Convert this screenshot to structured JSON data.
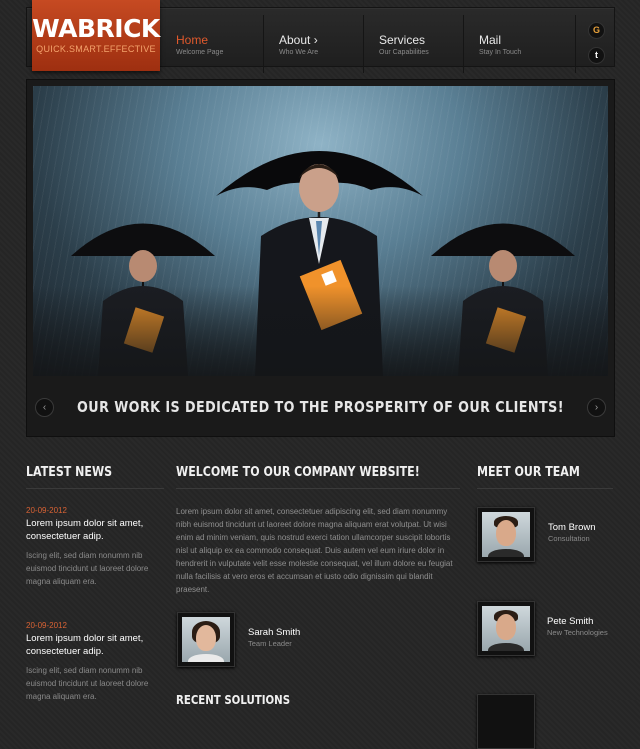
{
  "logo": {
    "name": "WABRICK",
    "tagline": "QUICK.SMART.EFFECTIVE"
  },
  "nav": [
    {
      "title": "Home",
      "sub": "Welcome Page",
      "active": true
    },
    {
      "title": "About ›",
      "sub": "Who We Are",
      "active": false
    },
    {
      "title": "Services",
      "sub": "Our Capabilities",
      "active": false
    },
    {
      "title": "Mail",
      "sub": "Stay In Touch",
      "active": false
    }
  ],
  "social": [
    {
      "icon": "google-icon",
      "glyph": "G"
    },
    {
      "icon": "twitter-icon",
      "glyph": "t"
    }
  ],
  "slider": {
    "caption": "OUR WORK IS DEDICATED TO THE PROSPERITY OF OUR CLIENTS!",
    "prev": "‹",
    "next": "›"
  },
  "latest_news": {
    "title": "LATEST NEWS",
    "items": [
      {
        "date": "20-09-2012",
        "headline": "Lorem ipsum dolor sit amet, consectetuer adip.",
        "text": "Iscing elit, sed diam nonumm nib euismod tincidunt ut laoreet dolore magna aliquam era."
      },
      {
        "date": "20-09-2012",
        "headline": "Lorem ipsum dolor sit amet, consectetuer adip.",
        "text": "Iscing elit, sed diam nonumm nib euismod tincidunt ut laoreet dolore magna aliquam era."
      }
    ]
  },
  "welcome": {
    "title": "WELCOME TO OUR COMPANY WEBSITE!",
    "text": "Lorem ipsum dolor sit amet, consectetuer adipiscing elit, sed diam nonummy nibh euismod tincidunt ut laoreet dolore magna aliquam erat volutpat. Ut wisi enim ad minim veniam, quis nostrud exerci tation ullamcorper suscipit lobortis nisl ut aliquip ex ea commodo consequat. Duis autem vel eum iriure dolor in hendrerit in vulputate velit esse molestie consequat, vel illum dolore eu feugiat nulla facilisis at vero eros et accumsan et iusto odio dignissim qui blandit praesent.",
    "member": {
      "name": "Sarah Smith",
      "role": "Team Leader"
    },
    "recent_title": "RECENT SOLUTIONS"
  },
  "team": {
    "title": "MEET OUR TEAM",
    "members": [
      {
        "name": "Tom Brown",
        "role": "Consultation"
      },
      {
        "name": "Pete Smith",
        "role": "New Technologies"
      }
    ]
  }
}
